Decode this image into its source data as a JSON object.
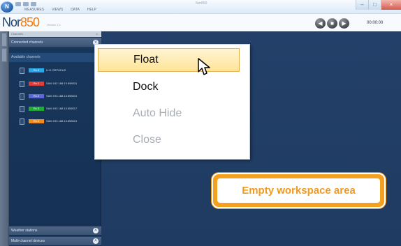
{
  "app": {
    "menu_items": [
      "MEASURES",
      "VIEWS",
      "DATA",
      "HELP"
    ],
    "window_title": "Nor850",
    "brand_prefix": "Nor",
    "brand_number": "850",
    "version": "Version 1.x",
    "time": "00:00:00"
  },
  "window_controls": {
    "minimize": "–",
    "maximize": "□",
    "close": "×"
  },
  "transport": {
    "prev": "◀",
    "stop": "■",
    "play": "▶"
  },
  "sidebar": {
    "header": "Channels",
    "pin": "×",
    "connected_section": "Connected channels",
    "available_section": "Available channels",
    "channels": [
      {
        "badge": "Rx 0",
        "label": "LLD ORPHEUS",
        "color": "#2aa7e8"
      },
      {
        "badge": "Rx 1",
        "label": "SAM 192.168.13.858031",
        "color": "#e33b35"
      },
      {
        "badge": "Rx 2",
        "label": "SAM 192.168.13.858031",
        "color": "#5a68d8"
      },
      {
        "badge": "Rx 3",
        "label": "SAM 192.168.13.858017",
        "color": "#1dad34"
      },
      {
        "badge": "Rx 4",
        "label": "SAM 192.168.13.858013",
        "color": "#ef8c1d"
      }
    ],
    "weather_stations": "Weather stations",
    "multi_channel_devices": "Multi-channel devices"
  },
  "context_menu": {
    "items": [
      {
        "label": "Float",
        "state": "hover"
      },
      {
        "label": "Dock",
        "state": "enabled"
      },
      {
        "label": "Auto Hide",
        "state": "disabled"
      },
      {
        "label": "Close",
        "state": "disabled"
      }
    ]
  },
  "callout": {
    "text": "Empty workspace area"
  },
  "colors": {
    "workspace": "#213e66",
    "sidebar": "#173459",
    "accent_orange": "#f4a020",
    "menu_hover": "#ffe497"
  }
}
